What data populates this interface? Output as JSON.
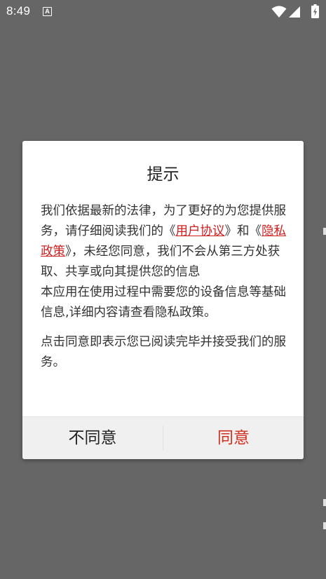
{
  "status_bar": {
    "time": "8:49",
    "notification_icon": "A",
    "icons": [
      "wifi-icon",
      "signal-icon",
      "battery-charging-icon"
    ]
  },
  "dialog": {
    "title": "提示",
    "paragraph1_before_link1": "我们依据最新的法律，为了更好的为您提供服务，请仔细阅读我们的《",
    "link1": "用户协议",
    "paragraph1_between_links": "》和《",
    "link2": "隐私政策",
    "paragraph1_after_link2": "》，未经您同意，我们不会从第三方处获取、共享或向其提供您的信息",
    "paragraph2": "本应用在使用过程中需要您的设备信息等基础信息,详细内容请查看隐私政策。",
    "paragraph3": "点击同意即表示您已阅读完毕并接受我们的服务。",
    "disagree_label": "不同意",
    "agree_label": "同意"
  },
  "colors": {
    "overlay_background": "#666666",
    "link": "#d01f1f",
    "agree_button_text": "#d0301f",
    "footer_background": "#f0f0f0"
  }
}
